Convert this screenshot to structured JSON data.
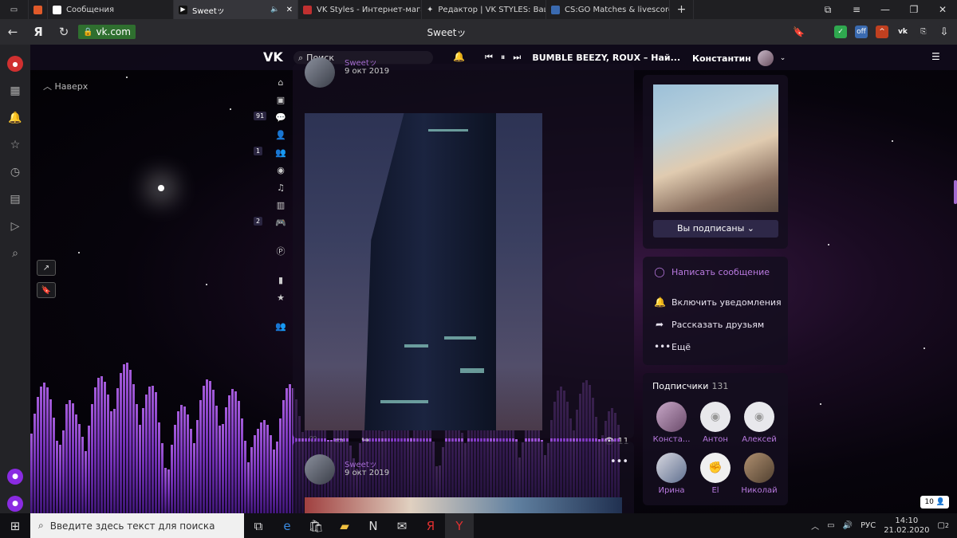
{
  "browser": {
    "tabs": [
      {
        "label": "",
        "icon": "media-icon",
        "color": "#e05a2a"
      },
      {
        "label": "Сообщения",
        "icon": "chat-icon",
        "color": "#ffffff"
      },
      {
        "label": "Sweetッ",
        "icon": "play-icon",
        "color": "#111111"
      },
      {
        "label": "VK Styles - Интернет-магаз",
        "icon": "vk-styles-icon",
        "color": "#c03030"
      },
      {
        "label": "Редактор | VK STYLES: Ваш",
        "icon": "sparkle-icon",
        "color": "#ffffff"
      },
      {
        "label": "CS:GO Matches & livescore",
        "icon": "csgo-icon",
        "color": "#3a6ab0"
      }
    ],
    "address": "vk.com",
    "page_title": "Sweetッ",
    "yandex_logo": "Я"
  },
  "vk": {
    "search_placeholder": "Поиск",
    "now_playing": "BUMBLE BEEZY, ROUX – Най...",
    "user_name": "Константин",
    "naverh": "Наверх",
    "nav_badges": {
      "messages": "91",
      "friends": "1",
      "games": "2"
    },
    "post1": {
      "author": "Sweetッ",
      "date": "9 окт 2019",
      "views": "11"
    },
    "post2": {
      "author": "Sweetッ",
      "date": "9 окт 2019"
    },
    "profile": {
      "subscribe_label": "Вы подписаны",
      "actions": [
        {
          "label": "Написать сообщение",
          "icon": "message-icon",
          "color": "#b97ae0"
        },
        {
          "label": "Включить уведомления",
          "icon": "bell-icon",
          "color": "#e8e3f0"
        },
        {
          "label": "Рассказать друзьям",
          "icon": "share-icon",
          "color": "#e8e3f0"
        },
        {
          "label": "Ещё",
          "icon": "more-icon",
          "color": "#e8e3f0"
        }
      ],
      "subscribers_label": "Подписчики",
      "subscribers_count": "131",
      "friends": [
        {
          "name": "Конста...",
          "photo": true
        },
        {
          "name": "Антон",
          "photo": false
        },
        {
          "name": "Алексей",
          "photo": false
        },
        {
          "name": "Ирина",
          "photo": true
        },
        {
          "name": "El",
          "photo": true
        },
        {
          "name": "Николай",
          "photo": true
        }
      ]
    },
    "online_count": "10"
  },
  "taskbar": {
    "search_placeholder": "Введите здесь текст для поиска",
    "lang": "РУС",
    "time": "14:10",
    "date": "21.02.2020",
    "notifications": "2"
  },
  "colors": {
    "accent": "#a46bd0",
    "equalizer": "#c06bff"
  }
}
